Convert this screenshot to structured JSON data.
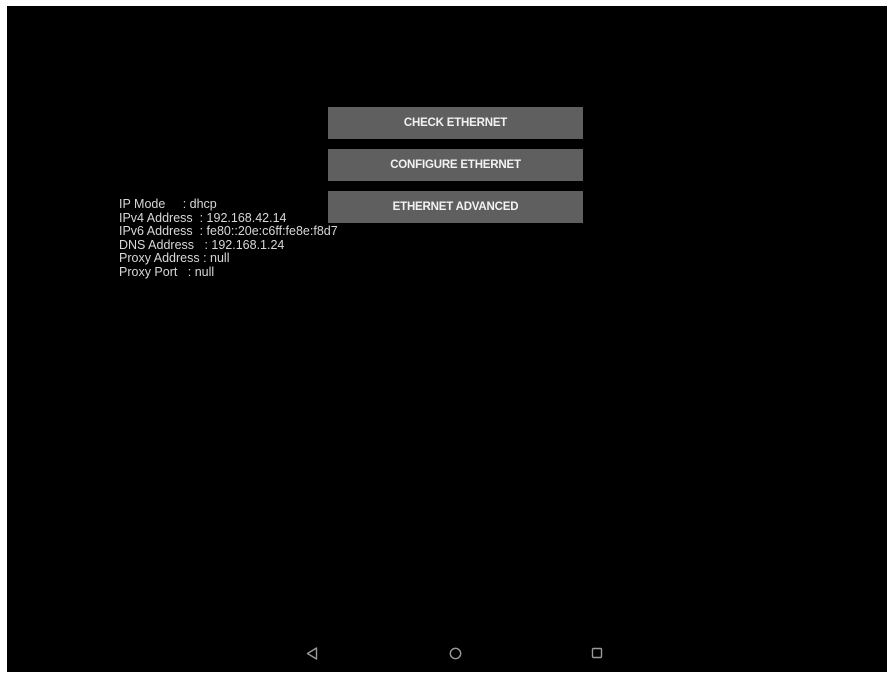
{
  "buttons": {
    "check": "CHECK ETHERNET",
    "configure": "CONFIGURE ETHERNET",
    "advanced": "ETHERNET ADVANCED"
  },
  "info": {
    "ip_mode": "IP Mode     : dhcp",
    "ipv4": "IPv4 Address  : 192.168.42.14",
    "ipv6": "IPv6 Address  : fe80::20e:c6ff:fe8e:f8d7",
    "dns": "DNS Address   : 192.168.1.24",
    "proxy_address": "Proxy Address : null",
    "proxy_port": "Proxy Port   : null"
  },
  "navbar": {
    "back_icon": "back-triangle",
    "home_icon": "home-circle",
    "recent_icon": "recents-square",
    "icon_color": "#9a9a9a"
  },
  "colors": {
    "background": "#000000",
    "button": "#5f5f5f",
    "text": "#d8d8d8"
  }
}
